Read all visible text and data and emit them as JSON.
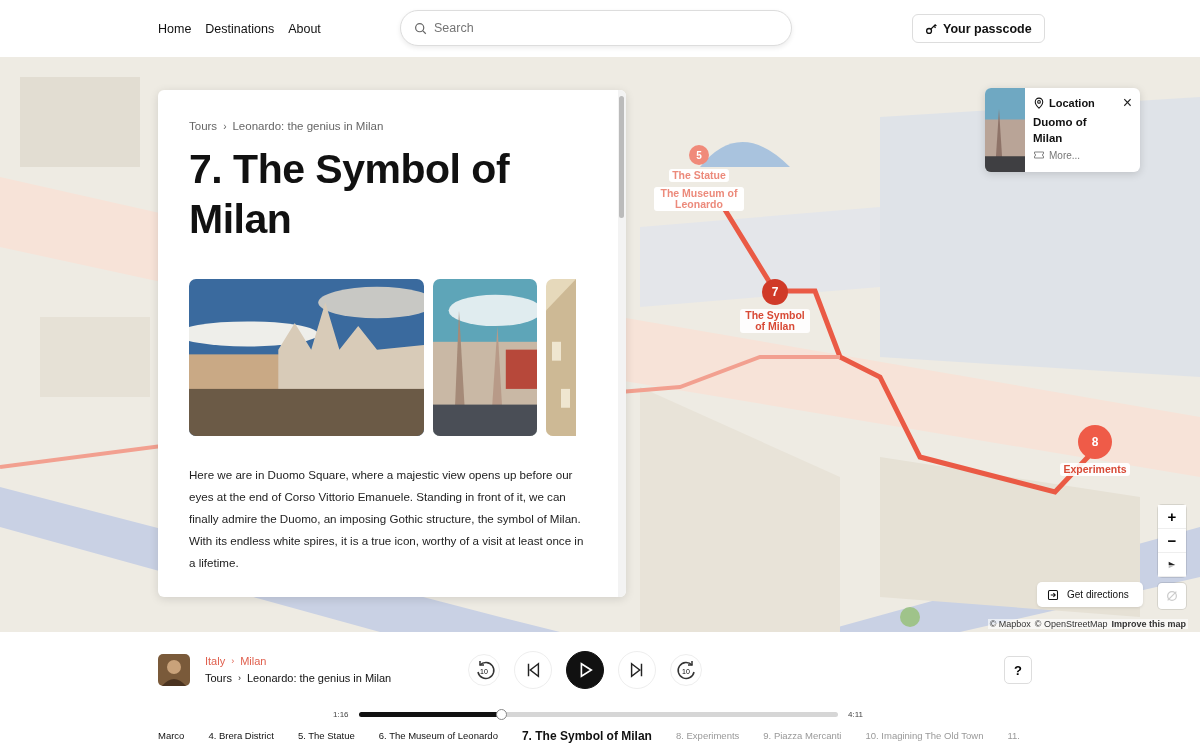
{
  "nav": {
    "links": [
      "Home",
      "Destinations",
      "About"
    ],
    "search": {
      "placeholder": "Search"
    },
    "passcode_button": "Your passcode"
  },
  "card": {
    "breadcrumb": [
      "Tours",
      "›",
      "Leonardo: the genius in Milan"
    ],
    "title": "7. The Symbol of Milan",
    "images": [
      {
        "kind": "picture"
      },
      {
        "kind": "picture"
      },
      {
        "kind": "picture"
      }
    ],
    "paragraph": "Here we are in Duomo Square, where a majestic view opens up before our eyes at the end of Corso Vittorio Emanuele. Standing in front of it, we can finally admire the Duomo, an imposing Gothic structure, the symbol of Milan. With its endless white spires, it is a true icon, worthy of a visit at least once in a lifetime."
  },
  "map": {
    "stops": [
      {
        "number": "5",
        "label": "The Statue",
        "past": true
      },
      {
        "label": "The Museum of Leonardo",
        "past": true
      },
      {
        "number": "7",
        "label": "The Symbol of Milan",
        "past": false
      },
      {
        "number": "8",
        "label": "Experiments",
        "past": false
      }
    ],
    "popup": {
      "heading": "Location",
      "close": "×",
      "place": "Duomo of Milan",
      "more": "More..."
    },
    "zoom_in": "+",
    "zoom_out": "−",
    "geolocate": {
      "disabled": true
    },
    "directions_button": "Get directions",
    "attribution": [
      "© Mapbox",
      "© OpenStreetMap",
      "Improve this map"
    ]
  },
  "player": {
    "location": [
      "Italy",
      "›",
      "Milan"
    ],
    "tour": [
      "Tours",
      "›",
      "Leonardo: the genius in Milan"
    ],
    "rewind": "10",
    "forward": "10",
    "help": "?",
    "elapsed": "1:16",
    "duration": "4:11",
    "progress": {
      "level": 0.3
    },
    "chapters": [
      {
        "label": "Marco",
        "played": true,
        "selected": false
      },
      {
        "label": "4. Brera District",
        "played": true,
        "selected": false
      },
      {
        "label": "5. The Statue",
        "played": true,
        "selected": false
      },
      {
        "label": "6. The Museum of Leonardo",
        "played": true,
        "selected": false
      },
      {
        "label": "7. The Symbol of Milan",
        "played": true,
        "selected": true
      },
      {
        "label": "8. Experiments",
        "played": false,
        "selected": false
      },
      {
        "label": "9. Piazza Mercanti",
        "played": false,
        "selected": false
      },
      {
        "label": "10. Imagining The Old Town",
        "played": false,
        "selected": false
      },
      {
        "label": "11.",
        "played": false,
        "selected": false
      }
    ]
  }
}
